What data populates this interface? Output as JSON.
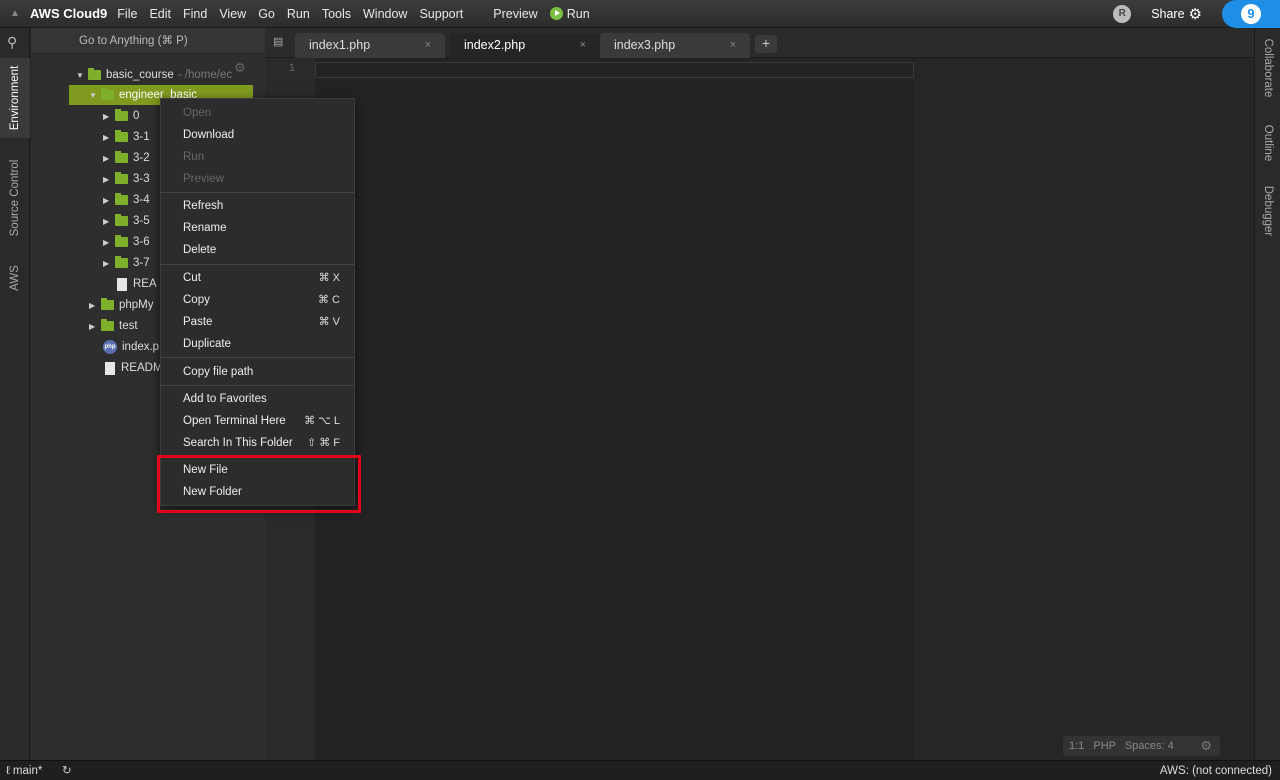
{
  "menubar": {
    "brand": "AWS Cloud9",
    "items": [
      "File",
      "Edit",
      "Find",
      "View",
      "Go",
      "Run",
      "Tools",
      "Window",
      "Support"
    ],
    "preview": "Preview",
    "run": "Run",
    "avatar_letter": "R",
    "share": "Share"
  },
  "left_tabs": [
    "Environment",
    "Source Control",
    "AWS"
  ],
  "right_tabs": [
    "Collaborate",
    "Outline",
    "Debugger"
  ],
  "goto_placeholder": "Go to Anything (⌘ P)",
  "tree": {
    "root": "basic_course",
    "root_path": "- /home/ec",
    "selected": "engineer_basic",
    "children": [
      "0",
      "3-1",
      "3-2",
      "3-3",
      "3-4",
      "3-5",
      "3-6",
      "3-7"
    ],
    "readme_inner": "REA",
    "siblings": [
      "phpMy",
      "test"
    ],
    "index_file": "index.p",
    "readme_outer": "READM"
  },
  "tabs": [
    {
      "label": "index1.php",
      "active": false
    },
    {
      "label": "index2.php",
      "active": true
    },
    {
      "label": "index3.php",
      "active": false
    }
  ],
  "gutter_line": "1",
  "editor_status": {
    "pos": "1:1",
    "lang": "PHP",
    "spaces": "Spaces: 4"
  },
  "statusbar": {
    "branch": "main*",
    "aws": "AWS: (not connected)"
  },
  "context_menu": {
    "open": "Open",
    "download": "Download",
    "run": "Run",
    "preview": "Preview",
    "refresh": "Refresh",
    "rename": "Rename",
    "delete": "Delete",
    "cut": "Cut",
    "cut_sc": "⌘ X",
    "copy": "Copy",
    "copy_sc": "⌘ C",
    "paste": "Paste",
    "paste_sc": "⌘ V",
    "duplicate": "Duplicate",
    "copy_path": "Copy file path",
    "add_favorites": "Add to Favorites",
    "open_terminal": "Open Terminal Here",
    "open_terminal_sc": "⌘ ⌥ L",
    "search_folder": "Search In This Folder",
    "search_folder_sc": "⇧ ⌘ F",
    "new_file": "New File",
    "new_folder": "New Folder"
  },
  "colors": {
    "highlight": "#e3001b",
    "selected_row": "#7f9a1f",
    "folder": "#7fb02b",
    "cloud9_blue": "#1e8ee6"
  }
}
